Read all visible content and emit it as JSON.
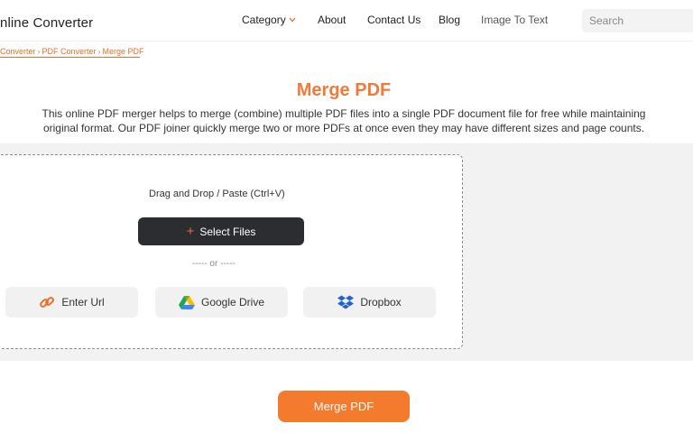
{
  "header": {
    "logo_text": "nline Converter",
    "nav": {
      "category": "Category",
      "about": "About",
      "contact": "Contact Us",
      "blog": "Blog",
      "image_to_text": "Image To Text"
    },
    "search_placeholder": "Search"
  },
  "breadcrumb": {
    "items": [
      "Converter",
      "PDF Converter",
      "Merge PDF"
    ],
    "separator": "›"
  },
  "main": {
    "title": "Merge PDF",
    "description": "This online PDF merger helps to merge (combine) multiple PDF files into a single PDF document file for free while maintaining original format. Our PDF joiner quickly merge two or more PDFs at once even they may have different sizes and page counts."
  },
  "upload": {
    "drag_text": "Drag and Drop / Paste (Ctrl+V)",
    "select_label": "Select Files",
    "or_text": "----- or -----",
    "sources": {
      "url": "Enter Url",
      "drive": "Google Drive",
      "dropbox": "Dropbox"
    }
  },
  "action": {
    "merge_label": "Merge PDF"
  },
  "colors": {
    "accent": "#ef6b2a",
    "title": "#ef7b3a",
    "merge_button": "#f47a2e",
    "select_button": "#2b2d30"
  },
  "icons": {
    "category_chevron": "chevron-down-icon",
    "select_plus": "plus-icon",
    "url": "link-icon",
    "drive": "google-drive-icon",
    "dropbox": "dropbox-icon"
  }
}
